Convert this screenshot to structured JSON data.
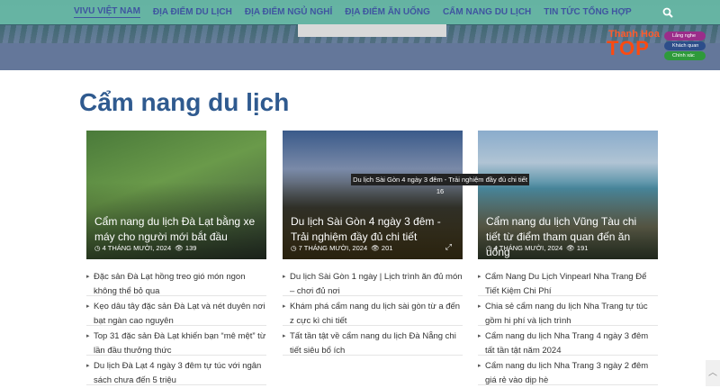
{
  "nav": {
    "items": [
      "VIVU VIỆT NAM",
      "ĐỊA ĐIỂM DU LỊCH",
      "ĐỊA ĐIỂM NGỦ NGHỈ",
      "ĐỊA ĐIỂM ĂN UỐNG",
      "CẨM NANG DU LỊCH",
      "TIN TỨC TỔNG HỢP"
    ],
    "search_icon": "search-icon"
  },
  "logo": {
    "line1": "Thanh Hoa",
    "line2": "TOP",
    "badges": [
      "Lắng nghe",
      "Khách quan",
      "Chính xác"
    ]
  },
  "section": {
    "title": "Cẩm nang du lịch"
  },
  "cards": [
    {
      "title": "Cẩm nang du lịch Đà Lạt bằng xe máy cho người mới bắt đầu",
      "date": "4 THÁNG MƯỜI, 2024",
      "views": "139"
    },
    {
      "title": "Du lịch Sài Gòn 4 ngày 3 đêm - Trải nghiệm đầy đủ chi tiết",
      "date": "7 THÁNG MƯỜI, 2024",
      "views": "201"
    },
    {
      "title": "Cẩm nang du lịch Vũng Tàu chi tiết từ điểm tham quan đến ăn uống",
      "date": "4 THÁNG MƯỜI, 2024",
      "views": "191"
    }
  ],
  "tooltip": "Du lịch Sài Gòn 4 ngày 3 đêm - Trải nghiệm đầy đủ chi tiết 16",
  "lists": [
    [
      "Đặc sản Đà Lạt hồng treo gió món ngon không thể bỏ qua",
      "Kẹo dâu tây đặc sản Đà Lạt và nét duyên nơi bạt ngàn cao nguyên",
      "Top 31 đặc sản Đà Lạt khiến bạn “mê mệt” từ lần đầu thưởng thức",
      "Du lịch Đà Lạt 4 ngày 3 đêm tự túc với ngân sách chưa đến 5 triệu"
    ],
    [
      "Du lịch Sài Gòn 1 ngày | Lịch trình ăn đủ món – chơi đủ nơi",
      "Khám phá cẩm nang du lịch sài gòn từ a đến z cực kì chi tiết",
      "Tất tần tật về cẩm nang du lịch Đà Nẵng chi tiết siêu bổ ích"
    ],
    [
      "Cẩm Nang Du Lịch Vinpearl Nha Trang Để Tiết Kiệm Chi Phí",
      "Chia sẻ cẩm nang du lịch Nha Trang tự túc gồm hi phí và lịch trình",
      "Cẩm nang du lịch Nha Trang 4 ngày 3 đêm tất tần tật năm 2024",
      "Cẩm nang du lịch Nha Trang 3 ngày 2 đêm giá rẻ vào dịp hè"
    ]
  ],
  "colors": {
    "nav_bg": "#6cbeaa",
    "nav_text": "#3f55a0",
    "heading": "#2f5a8f"
  }
}
